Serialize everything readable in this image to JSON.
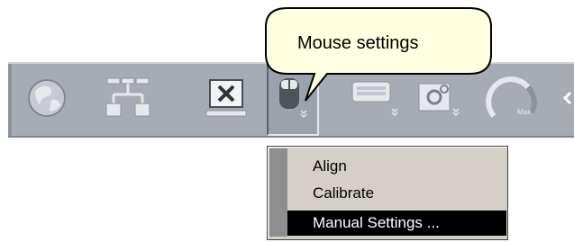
{
  "toolbar": {
    "buttons": [
      {
        "name": "globe-icon"
      },
      {
        "name": "network-icon"
      },
      {
        "name": "close-window-icon"
      },
      {
        "name": "mouse-icon",
        "state": "pressed"
      },
      {
        "name": "keyboard-icon"
      },
      {
        "name": "settings-gear-icon"
      },
      {
        "name": "gauge-icon",
        "label": "Max"
      }
    ]
  },
  "tooltip": {
    "text": "Mouse settings"
  },
  "menu": {
    "items": [
      {
        "label": "Align"
      },
      {
        "label": "Calibrate"
      },
      {
        "label": "Manual Settings ...",
        "selected": true
      }
    ]
  },
  "colors": {
    "toolbar_bg": "#a7acb4",
    "tooltip_bg": "#ffffe1",
    "menu_bg": "#d4d0c8",
    "selection_bg": "#000000"
  }
}
